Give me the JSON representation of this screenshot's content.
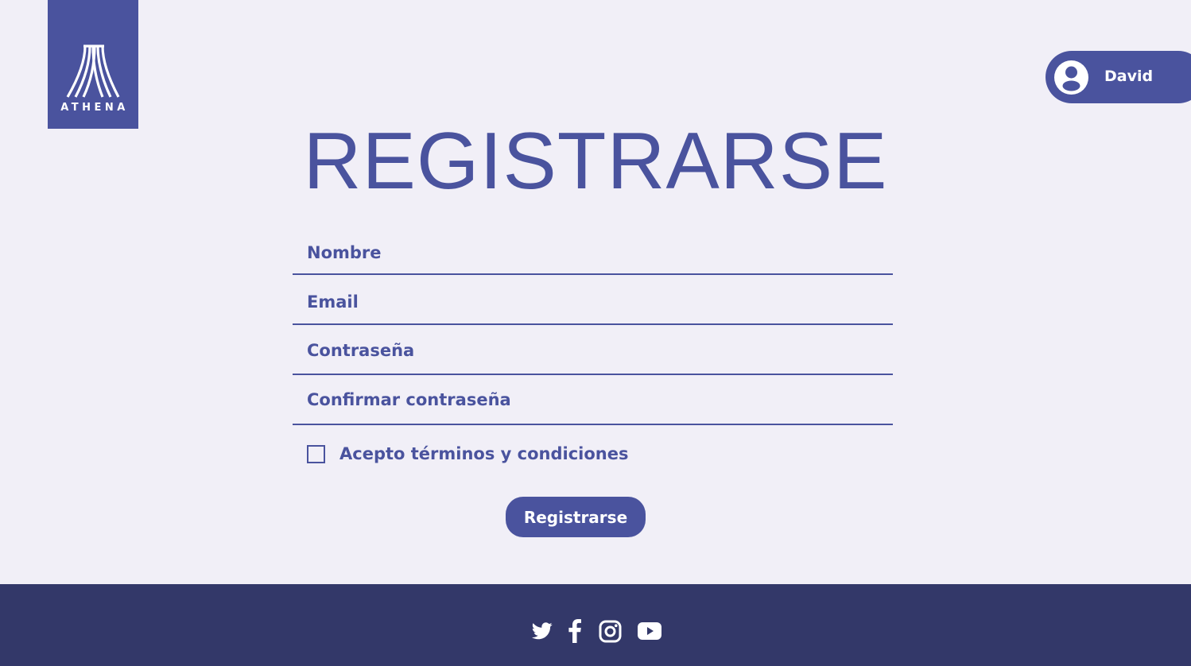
{
  "brand": {
    "logo_text": "ATHENA",
    "primary_color": "#4a539e",
    "background_color": "#f1eff7",
    "footer_color": "#333869"
  },
  "user": {
    "name": "David",
    "icon": "user-avatar-icon"
  },
  "page": {
    "title": "REGISTRARSE"
  },
  "form": {
    "name_placeholder": "Nombre",
    "email_placeholder": "Email",
    "password_placeholder": "Contraseña",
    "confirm_password_placeholder": "Confirmar contraseña",
    "terms_label": "Acepto términos y condiciones",
    "terms_checked": false,
    "submit_label": "Registrarse"
  },
  "footer": {
    "social_icons": [
      "twitter-icon",
      "facebook-icon",
      "instagram-icon",
      "youtube-icon"
    ]
  }
}
